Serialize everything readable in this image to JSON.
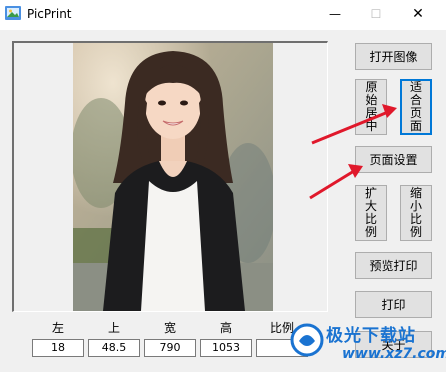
{
  "window": {
    "title": "PicPrint",
    "minimize_glyph": "—",
    "maximize_glyph": "☐",
    "close_glyph": "✕"
  },
  "buttons": {
    "open_image": "打开图像",
    "original_center": "原始居中",
    "fit_page": "适合页面",
    "page_setup": "页面设置",
    "zoom_in": "扩大比例",
    "zoom_out": "缩小比例",
    "print_preview": "预览打印",
    "print": "打印",
    "about": "关于"
  },
  "fields": {
    "left": {
      "label": "左",
      "value": "18"
    },
    "top": {
      "label": "上",
      "value": "48.5"
    },
    "width": {
      "label": "宽",
      "value": "790"
    },
    "height": {
      "label": "高",
      "value": "1053"
    },
    "scale": {
      "label": "比例",
      "value": ""
    }
  },
  "watermark": {
    "brand": "极光下载站",
    "url": "www.xz7.com"
  },
  "colors": {
    "accent": "#0078d7",
    "annotation_arrow": "#e0182b",
    "watermark": "#1a73d1"
  },
  "icons": {
    "app": "printer-photo-icon",
    "annotations": [
      "red-arrow-icon",
      "red-arrow-icon"
    ]
  }
}
